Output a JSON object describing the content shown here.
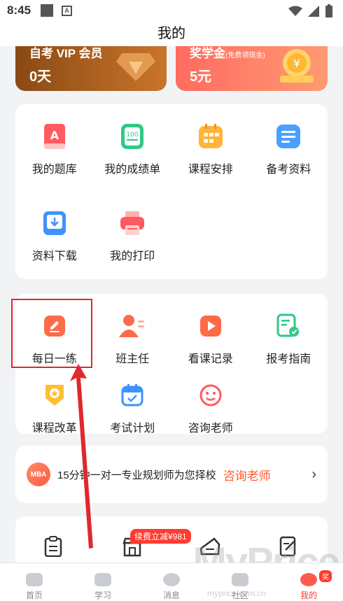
{
  "status": {
    "time": "8:45"
  },
  "header": {
    "title": "我的"
  },
  "banners": {
    "vip": {
      "title": "自考 VIP 会员",
      "value": "0天"
    },
    "scholarship": {
      "title": "奖学金",
      "note": "(免费领现金)",
      "value": "5元"
    }
  },
  "section1": {
    "items": [
      {
        "label": "我的题库",
        "icon": "question-bank-icon",
        "color": "#ff5a5f"
      },
      {
        "label": "我的成绩单",
        "icon": "transcript-icon",
        "color": "#2ec985"
      },
      {
        "label": "课程安排",
        "icon": "calendar-icon",
        "color": "#ffb43a"
      },
      {
        "label": "备考资料",
        "icon": "document-icon",
        "color": "#4aa0ff"
      },
      {
        "label": "资料下载",
        "icon": "download-icon",
        "color": "#3d92ff"
      },
      {
        "label": "我的打印",
        "icon": "printer-icon",
        "color": "#ff5a5f"
      }
    ]
  },
  "section2": {
    "items": [
      {
        "label": "每日一练",
        "icon": "edit-icon",
        "color": "#ff6a48"
      },
      {
        "label": "班主任",
        "icon": "teacher-icon",
        "color": "#ff6a48"
      },
      {
        "label": "看课记录",
        "icon": "play-icon",
        "color": "#ff6a48"
      },
      {
        "label": "报考指南",
        "icon": "guide-icon",
        "color": "#2ec985"
      },
      {
        "label": "课程改革",
        "icon": "badge-icon",
        "color": "#ffc02e"
      },
      {
        "label": "考试计划",
        "icon": "plan-icon",
        "color": "#3d92ff"
      },
      {
        "label": "咨询老师",
        "icon": "consult-icon",
        "color": "#ff5a5f"
      }
    ]
  },
  "promo": {
    "badge": "MBA",
    "text": "15分钟一对一专业规划师为您择校",
    "link": "咨询老师"
  },
  "discount": "续费立减¥981",
  "tabs": [
    {
      "label": "首页",
      "icon": "home-icon"
    },
    {
      "label": "学习",
      "icon": "study-icon"
    },
    {
      "label": "消息",
      "icon": "message-icon"
    },
    {
      "label": "社区",
      "icon": "community-icon"
    },
    {
      "label": "我的",
      "icon": "profile-icon",
      "badge": "奖"
    }
  ],
  "watermark": {
    "main": "MyPrice",
    "sub": "myprice.com.cn"
  }
}
